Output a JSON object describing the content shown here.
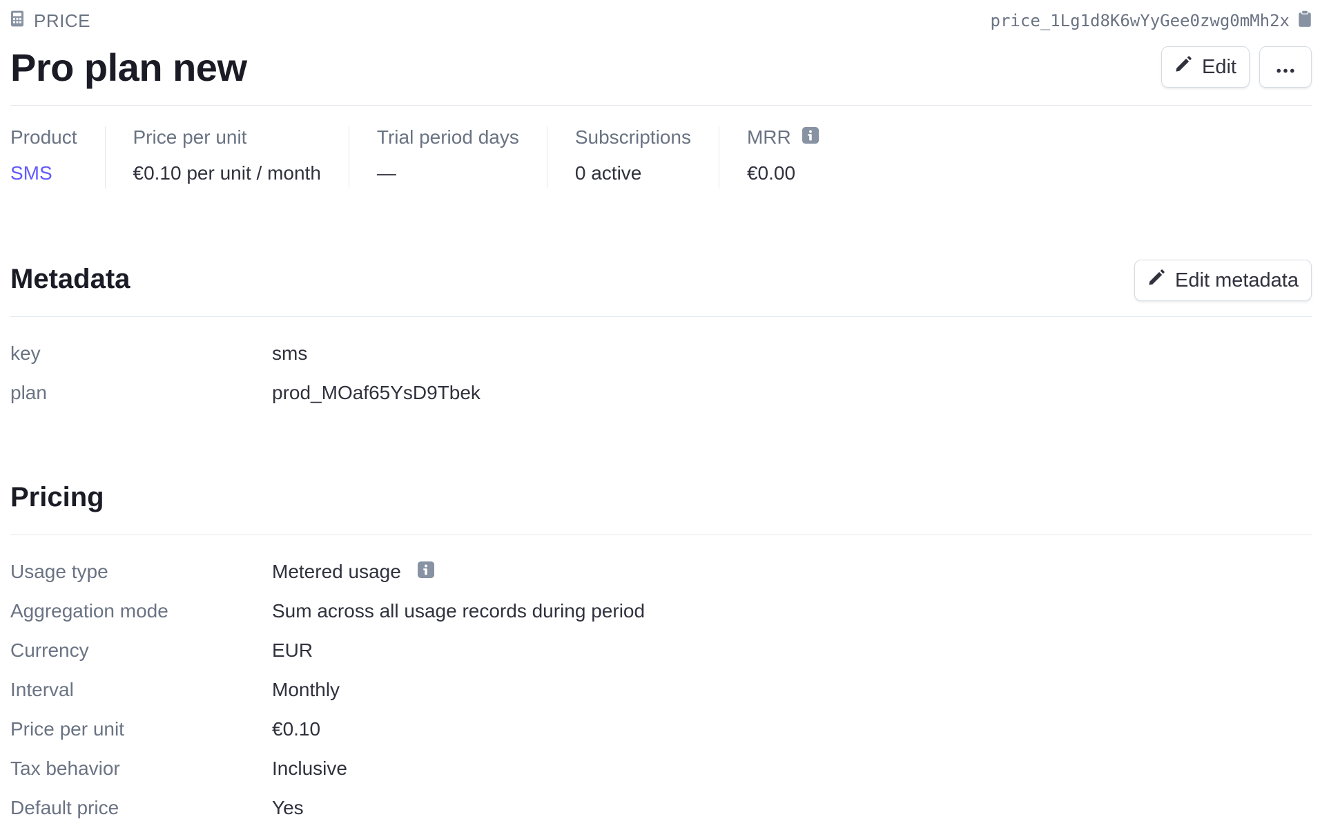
{
  "header": {
    "type_label": "PRICE",
    "price_id": "price_1Lg1d8K6wYyGee0zwg0mMh2x",
    "title": "Pro plan new",
    "edit_label": "Edit",
    "more_label": "•••"
  },
  "summary": [
    {
      "label": "Product",
      "value": "SMS"
    },
    {
      "label": "Price per unit",
      "value": "€0.10 per unit / month"
    },
    {
      "label": "Trial period days",
      "value": "—"
    },
    {
      "label": "Subscriptions",
      "value": "0 active"
    },
    {
      "label": "MRR",
      "value": "€0.00"
    }
  ],
  "metadata": {
    "title": "Metadata",
    "edit_label": "Edit metadata",
    "rows": [
      {
        "key": "key",
        "value": "sms"
      },
      {
        "key": "plan",
        "value": "prod_MOaf65YsD9Tbek"
      }
    ]
  },
  "pricing": {
    "title": "Pricing",
    "rows": [
      {
        "key": "Usage type",
        "value": "Metered usage"
      },
      {
        "key": "Aggregation mode",
        "value": "Sum across all usage records during period"
      },
      {
        "key": "Currency",
        "value": "EUR"
      },
      {
        "key": "Interval",
        "value": "Monthly"
      },
      {
        "key": "Price per unit",
        "value": "€0.10"
      },
      {
        "key": "Tax behavior",
        "value": "Inclusive"
      },
      {
        "key": "Default price",
        "value": "Yes"
      }
    ]
  },
  "icons": {
    "type": "calculator-icon",
    "copy": "clipboard-icon",
    "edit": "pencil-icon",
    "info": "info-icon"
  },
  "colors": {
    "accent": "#625afa",
    "muted_text": "#6a7383",
    "primary_text": "#1a1b25",
    "divider": "#e3e8ee"
  }
}
